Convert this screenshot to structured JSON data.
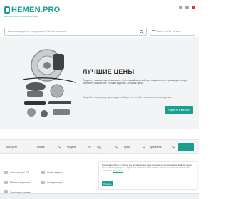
{
  "header": {
    "logo_text": "HEMEN.PRO",
    "logo_tagline": "АВТОЗАПЧАСТИ И АКСЕССУАРЫ",
    "search_placeholder": "Искать код детали, информацию PN или описание",
    "vin_label": "Поиск по VIN / кузову"
  },
  "hero": {
    "title": "ЛУЧШИЕ ЦЕНЫ",
    "text": "Покупка у нас в интернет-магазине – это самый короткий путь покупателя от производителя до конечного покупателя: Лучшие изделия – лучшие цены!",
    "sub": "Покупайте напрямую у производителей для того, чтобы сэкономить на посредниках",
    "button_label": "Перейти в каталог"
  },
  "filters": {
    "items": [
      "Выберите",
      "Марка",
      "Модель",
      "Год",
      "Кузов",
      "Двигатель"
    ]
  },
  "categories": {
    "items": [
      "Запчасти для ТО",
      "Шины и диски",
      "Масла и жидкости",
      "Аккумуляторы",
      "Тормозная система"
    ]
  },
  "cookie": {
    "text": "Продолжая работу с сайтом, Вы подтверждаете свое согласие на использование файлов cookie вашего браузера с целью улучшения предложений и сервиса на основе ваших предпочтений и интересов.",
    "link_label": "Подробнее",
    "button_label": "Принять"
  },
  "colors": {
    "accent": "#1a9e8f",
    "hero_bg": "#f2f4f5"
  }
}
